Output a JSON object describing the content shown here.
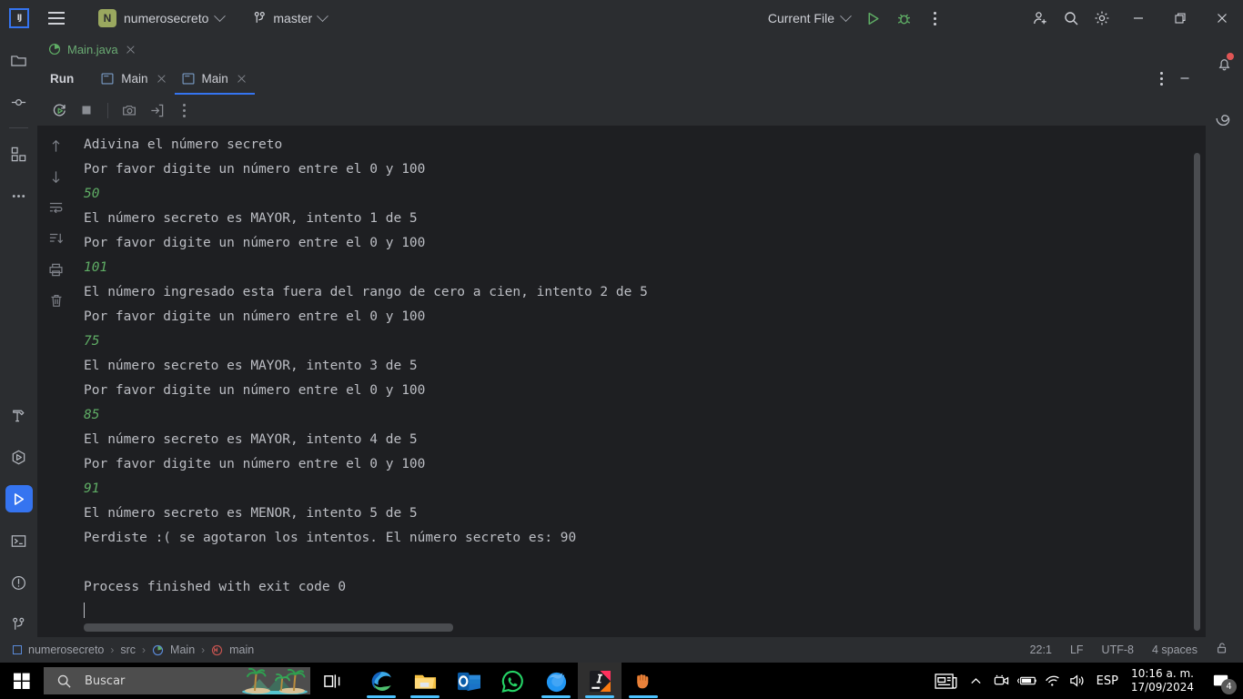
{
  "titlebar": {
    "logo_icon": "intellij-logo-icon",
    "menu_icon": "hamburger-menu-icon",
    "project_badge": "N",
    "project_name": "numerosecreto",
    "branch_icon": "git-branch-icon",
    "branch_name": "master",
    "run_config": "Current File",
    "run_icon": "run-play-icon",
    "debug_icon": "debug-bug-icon",
    "more_icon": "more-vertical-icon",
    "share_icon": "add-user-icon",
    "search_icon": "search-icon",
    "settings_icon": "gear-icon",
    "minimize_icon": "window-minimize-icon",
    "maximize_icon": "window-maximize-icon",
    "close_icon": "window-close-icon"
  },
  "left_rail": {
    "top": [
      {
        "name": "project-folder-icon"
      },
      {
        "name": "commit-icon"
      },
      {
        "name": "structure-icon"
      },
      {
        "name": "more-tools-icon"
      }
    ],
    "bottom": [
      {
        "name": "build-hammer-icon",
        "selected": false
      },
      {
        "name": "services-icon",
        "selected": false
      },
      {
        "name": "run-tool-icon",
        "selected": true
      },
      {
        "name": "terminal-icon",
        "selected": false
      },
      {
        "name": "problems-icon",
        "selected": false
      },
      {
        "name": "git-icon",
        "selected": false
      }
    ]
  },
  "right_rail": {
    "notifications_icon": "bell-notification-icon",
    "ai_assistant_icon": "ai-assistant-spiral-icon"
  },
  "editor_tabs": [
    {
      "label": "Main.java",
      "icon": "java-class-icon",
      "close_icon": "close-icon"
    }
  ],
  "run_panel": {
    "title": "Run",
    "tabs": [
      {
        "label": "Main",
        "icon": "console-icon",
        "active": false,
        "close_icon": "close-icon"
      },
      {
        "label": "Main",
        "icon": "console-icon",
        "active": true,
        "close_icon": "close-icon"
      }
    ],
    "header_more_icon": "more-vertical-icon",
    "header_hide_icon": "hide-panel-icon",
    "toolbar": [
      {
        "name": "rerun-icon"
      },
      {
        "name": "stop-icon"
      },
      {
        "name": "screenshot-camera-icon"
      },
      {
        "name": "export-icon"
      },
      {
        "name": "toolbar-more-icon"
      }
    ],
    "gutter": [
      {
        "name": "scroll-up-icon"
      },
      {
        "name": "scroll-down-icon"
      },
      {
        "name": "soft-wrap-icon"
      },
      {
        "name": "scroll-to-end-icon"
      },
      {
        "name": "print-icon"
      },
      {
        "name": "clear-all-trash-icon"
      }
    ],
    "console_lines": [
      {
        "text": "Adivina el número secreto",
        "type": "output"
      },
      {
        "text": "Por favor digite un número entre el 0 y 100",
        "type": "output"
      },
      {
        "text": "50",
        "type": "input"
      },
      {
        "text": "El número secreto es MAYOR, intento 1 de 5",
        "type": "output"
      },
      {
        "text": "Por favor digite un número entre el 0 y 100",
        "type": "output"
      },
      {
        "text": "101",
        "type": "input"
      },
      {
        "text": "El número ingresado esta fuera del rango de cero a cien, intento 2 de 5",
        "type": "output"
      },
      {
        "text": "Por favor digite un número entre el 0 y 100",
        "type": "output"
      },
      {
        "text": "75",
        "type": "input"
      },
      {
        "text": "El número secreto es MAYOR, intento 3 de 5",
        "type": "output"
      },
      {
        "text": "Por favor digite un número entre el 0 y 100",
        "type": "output"
      },
      {
        "text": "85",
        "type": "input"
      },
      {
        "text": "El número secreto es MAYOR, intento 4 de 5",
        "type": "output"
      },
      {
        "text": "Por favor digite un número entre el 0 y 100",
        "type": "output"
      },
      {
        "text": "91",
        "type": "input"
      },
      {
        "text": "El número secreto es MENOR, intento 5 de 5",
        "type": "output"
      },
      {
        "text": "Perdiste :( se agotaron los intentos. El número secreto es: 90",
        "type": "output"
      },
      {
        "text": "",
        "type": "output"
      },
      {
        "text": "Process finished with exit code 0",
        "type": "output"
      }
    ]
  },
  "status_bar": {
    "breadcrumbs": [
      {
        "label": "numerosecreto",
        "icon": "module-icon"
      },
      {
        "label": "src",
        "icon": ""
      },
      {
        "label": "Main",
        "icon": "java-class-icon"
      },
      {
        "label": "main",
        "icon": "method-icon"
      }
    ],
    "caret_position": "22:1",
    "line_separator": "LF",
    "encoding": "UTF-8",
    "indent": "4 spaces",
    "lock_icon": "unlocked-padlock-icon"
  },
  "taskbar": {
    "start_icon": "windows-start-icon",
    "search_icon": "search-icon",
    "search_placeholder": "Buscar",
    "search_decoration_icon": "palm-island-icon",
    "task_view_icon": "task-view-icon",
    "apps": [
      {
        "name": "microsoft-edge-icon",
        "running": true,
        "active": false
      },
      {
        "name": "file-explorer-icon",
        "running": true,
        "active": false
      },
      {
        "name": "outlook-icon",
        "running": false,
        "active": false
      },
      {
        "name": "whatsapp-icon",
        "running": false,
        "active": false
      },
      {
        "name": "firefox-icon",
        "running": true,
        "active": false
      },
      {
        "name": "intellij-idea-icon",
        "running": true,
        "active": true
      },
      {
        "name": "hand-app-icon",
        "running": true,
        "active": false
      }
    ],
    "tray": [
      {
        "name": "news-weather-icon"
      },
      {
        "name": "show-hidden-icons-chevron-icon"
      },
      {
        "name": "camera-icon"
      },
      {
        "name": "battery-charging-icon"
      },
      {
        "name": "wifi-icon"
      },
      {
        "name": "volume-icon"
      }
    ],
    "language": "ESP",
    "time": "10:16 a. m.",
    "date": "17/09/2024",
    "notification_icon": "action-center-icon",
    "notification_count": "4"
  },
  "colors": {
    "accent_blue": "#3574f0",
    "console_text": "#bcbec4",
    "console_input": "#5fad65",
    "tab_green": "#6aab73",
    "panel_bg": "#2b2d30",
    "editor_bg": "#1e1f22"
  }
}
